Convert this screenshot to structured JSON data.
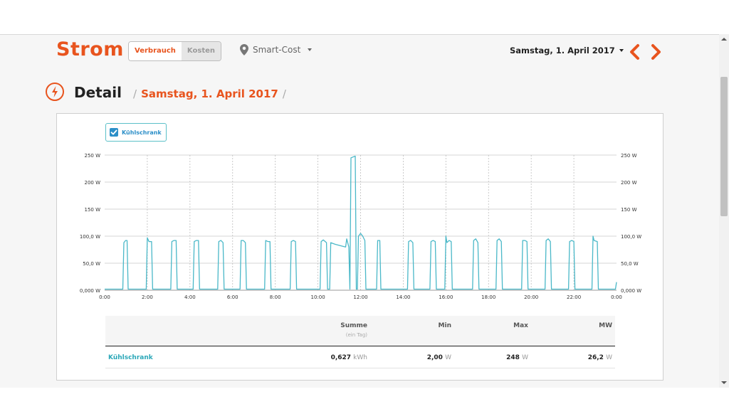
{
  "header": {
    "title": "Strom",
    "tabs": [
      {
        "label": "Verbrauch",
        "active": true
      },
      {
        "label": "Kosten",
        "active": false
      }
    ],
    "location_icon": "map-marker-icon",
    "location": "Smart-Cost",
    "date": "Samstag, 1. April 2017"
  },
  "detail": {
    "icon": "lightning-bolt-icon",
    "title": "Detail",
    "sep1": "/",
    "date": "Samstag,  1. April 2017",
    "sep2": "/"
  },
  "legend": {
    "checkbox_label": "Kühlschrank",
    "checked": true
  },
  "colors": {
    "accent": "#e8541e",
    "series": "#4ab8c8",
    "link": "#2c8fc8"
  },
  "chart_data": {
    "type": "line",
    "title": "",
    "xlabel": "",
    "ylabel": "",
    "x_ticks": [
      "0:00",
      "2:00",
      "4:00",
      "6:00",
      "8:00",
      "10:00",
      "12:00",
      "14:00",
      "16:00",
      "18:00",
      "20:00",
      "22:00",
      "0:00"
    ],
    "y_ticks": [
      "0,000 W",
      "50,0 W",
      "100,0 W",
      "150 W",
      "200 W",
      "250 W"
    ],
    "y_ticks_right": [
      "0,000 W",
      "50,0 W",
      "100,0 W",
      "150 W",
      "200 W",
      "250 W"
    ],
    "xlim_hours": [
      0,
      24
    ],
    "ylim": [
      0,
      250
    ],
    "grid": true,
    "series": [
      {
        "name": "Kühlschrank",
        "points": [
          [
            0,
            2
          ],
          [
            0.85,
            2
          ],
          [
            0.9,
            88
          ],
          [
            0.98,
            92
          ],
          [
            1.05,
            92
          ],
          [
            1.1,
            2
          ],
          [
            1.95,
            2
          ],
          [
            2.0,
            97
          ],
          [
            2.08,
            90
          ],
          [
            2.2,
            90
          ],
          [
            2.25,
            2
          ],
          [
            3.1,
            2
          ],
          [
            3.15,
            90
          ],
          [
            3.25,
            92
          ],
          [
            3.35,
            92
          ],
          [
            3.4,
            2
          ],
          [
            4.15,
            2
          ],
          [
            4.2,
            90
          ],
          [
            4.3,
            92
          ],
          [
            4.4,
            92
          ],
          [
            4.45,
            2
          ],
          [
            5.3,
            2
          ],
          [
            5.35,
            90
          ],
          [
            5.45,
            92
          ],
          [
            5.55,
            88
          ],
          [
            5.6,
            2
          ],
          [
            6.35,
            2
          ],
          [
            6.4,
            92
          ],
          [
            6.5,
            92
          ],
          [
            6.6,
            88
          ],
          [
            6.65,
            2
          ],
          [
            7.5,
            2
          ],
          [
            7.55,
            92
          ],
          [
            7.65,
            90
          ],
          [
            7.75,
            90
          ],
          [
            7.8,
            2
          ],
          [
            8.7,
            2
          ],
          [
            8.75,
            90
          ],
          [
            8.85,
            92
          ],
          [
            8.95,
            90
          ],
          [
            9.0,
            2
          ],
          [
            10.1,
            2
          ],
          [
            10.15,
            90
          ],
          [
            10.25,
            93
          ],
          [
            10.4,
            88
          ],
          [
            10.45,
            2
          ],
          [
            10.55,
            2
          ],
          [
            10.6,
            88
          ],
          [
            10.8,
            85
          ],
          [
            11.1,
            82
          ],
          [
            11.3,
            80
          ],
          [
            11.35,
            95
          ],
          [
            11.45,
            80
          ],
          [
            11.5,
            2
          ],
          [
            11.55,
            245
          ],
          [
            11.75,
            248
          ],
          [
            11.8,
            2
          ],
          [
            11.85,
            2
          ],
          [
            11.9,
            100
          ],
          [
            12.0,
            105
          ],
          [
            12.1,
            100
          ],
          [
            12.2,
            92
          ],
          [
            12.25,
            2
          ],
          [
            12.75,
            2
          ],
          [
            12.8,
            92
          ],
          [
            12.9,
            92
          ],
          [
            12.95,
            2
          ],
          [
            14.2,
            2
          ],
          [
            14.25,
            90
          ],
          [
            14.35,
            92
          ],
          [
            14.45,
            88
          ],
          [
            14.5,
            2
          ],
          [
            15.25,
            2
          ],
          [
            15.3,
            90
          ],
          [
            15.4,
            92
          ],
          [
            15.5,
            90
          ],
          [
            15.55,
            2
          ],
          [
            15.95,
            2
          ],
          [
            16.0,
            100
          ],
          [
            16.05,
            88
          ],
          [
            16.15,
            92
          ],
          [
            16.25,
            90
          ],
          [
            16.3,
            2
          ],
          [
            17.25,
            2
          ],
          [
            17.3,
            92
          ],
          [
            17.4,
            95
          ],
          [
            17.5,
            88
          ],
          [
            17.55,
            2
          ],
          [
            18.35,
            2
          ],
          [
            18.4,
            92
          ],
          [
            18.5,
            95
          ],
          [
            18.6,
            90
          ],
          [
            18.65,
            2
          ],
          [
            19.55,
            2
          ],
          [
            19.6,
            92
          ],
          [
            19.7,
            92
          ],
          [
            19.8,
            90
          ],
          [
            19.85,
            2
          ],
          [
            20.65,
            2
          ],
          [
            20.7,
            92
          ],
          [
            20.8,
            95
          ],
          [
            20.9,
            90
          ],
          [
            20.95,
            2
          ],
          [
            21.75,
            2
          ],
          [
            21.8,
            90
          ],
          [
            21.9,
            92
          ],
          [
            22.0,
            90
          ],
          [
            22.05,
            2
          ],
          [
            22.85,
            2
          ],
          [
            22.9,
            100
          ],
          [
            22.95,
            92
          ],
          [
            23.1,
            90
          ],
          [
            23.15,
            2
          ],
          [
            23.95,
            2
          ],
          [
            24.0,
            15
          ]
        ]
      }
    ]
  },
  "table": {
    "headers": [
      {
        "label": "Summe",
        "sub": "(ein Tag)"
      },
      {
        "label": "Min"
      },
      {
        "label": "Max"
      },
      {
        "label": "MW"
      }
    ],
    "rows": [
      {
        "name": "Kühlschrank",
        "summe": "0,627",
        "summe_unit": "kWh",
        "min": "2,00",
        "min_unit": "W",
        "max": "248",
        "max_unit": "W",
        "mw": "26,2",
        "mw_unit": "W"
      }
    ]
  }
}
